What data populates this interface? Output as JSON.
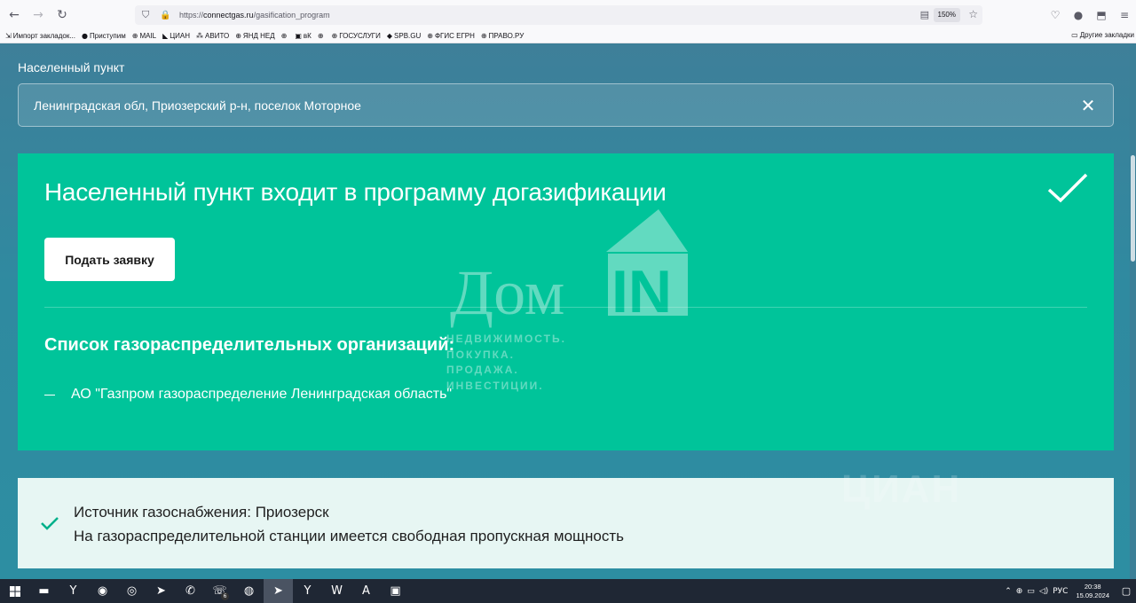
{
  "browser": {
    "url_prefix": "https://",
    "url_host": "connectgas.ru",
    "url_path": "/gasification_program",
    "zoom": "150%",
    "bookmarks": [
      {
        "icon": "import-icon",
        "glyph": "⇲",
        "label": "Импорт закладок..."
      },
      {
        "icon": "yandex-icon",
        "glyph": "●",
        "label": "Приступим"
      },
      {
        "icon": "globe-icon",
        "glyph": "⊕",
        "label": "MAIL"
      },
      {
        "icon": "cian-icon",
        "glyph": "◣",
        "label": "ЦИАН"
      },
      {
        "icon": "avito-icon",
        "glyph": "⁂",
        "label": "АВИТО"
      },
      {
        "icon": "globe-icon",
        "glyph": "⊕",
        "label": "ЯНД НЕД"
      },
      {
        "icon": "globe-icon",
        "glyph": "⊕",
        "label": ""
      },
      {
        "icon": "vk-icon",
        "glyph": "▣",
        "label": "вК"
      },
      {
        "icon": "globe-icon",
        "glyph": "⊕",
        "label": ""
      },
      {
        "icon": "globe-icon",
        "glyph": "⊕",
        "label": "ГОСУСЛУГИ"
      },
      {
        "icon": "spb-icon",
        "glyph": "◆",
        "label": "SPB.GU"
      },
      {
        "icon": "globe-icon",
        "glyph": "⊕",
        "label": "ФГИС ЕГРН"
      },
      {
        "icon": "globe-icon",
        "glyph": "⊕",
        "label": "ПРАВО.РУ"
      }
    ],
    "other_bookmarks": "Другие закладки"
  },
  "page": {
    "locality_label": "Населенный пункт",
    "locality_value": "Ленинградская обл, Приозерский р-н, поселок Моторное",
    "status_title": "Населенный пункт входит в программу догазификации",
    "apply_button": "Подать заявку",
    "orgs_title": "Список газораспределительных организаций:",
    "orgs": [
      "АО \"Газпром газораспределение Ленинградская область\""
    ],
    "source_line": "Источник газоснабжения: Приозерск",
    "capacity_line": "На газораспределительной станции имеется свободная пропускная мощность"
  },
  "watermark": {
    "brand_text": "Дом",
    "brand_in": "IN",
    "tagline": "НЕДВИЖИМОСТЬ.\nПОКУПКА.\nПРОДАЖА.\nИНВЕСТИЦИИ.",
    "cian": "ЦИАН"
  },
  "taskbar": {
    "apps": [
      {
        "name": "explorer-icon",
        "glyph": "▬"
      },
      {
        "name": "yandex-browser-icon",
        "glyph": "Y"
      },
      {
        "name": "firefox-icon",
        "glyph": "◉"
      },
      {
        "name": "chrome-icon",
        "glyph": "◎"
      },
      {
        "name": "telegram-icon",
        "glyph": "➤"
      },
      {
        "name": "viber-icon",
        "glyph": "✆"
      },
      {
        "name": "whatsapp-icon",
        "glyph": "☏",
        "badge": "6"
      },
      {
        "name": "globe-app-icon",
        "glyph": "◍"
      },
      {
        "name": "telegram2-icon",
        "glyph": "➤",
        "active": true
      },
      {
        "name": "yandex2-icon",
        "glyph": "Y"
      },
      {
        "name": "word-icon",
        "glyph": "W"
      },
      {
        "name": "acrobat-icon",
        "glyph": "A"
      },
      {
        "name": "screen-icon",
        "glyph": "▣"
      }
    ],
    "lang": "РУС",
    "time": "20:38",
    "date": "15.09.2024"
  },
  "colors": {
    "green_card": "#00c49a",
    "page_bg": "#3a7d95",
    "info_bg": "#e7f6f3",
    "check_green": "#00b08a"
  }
}
